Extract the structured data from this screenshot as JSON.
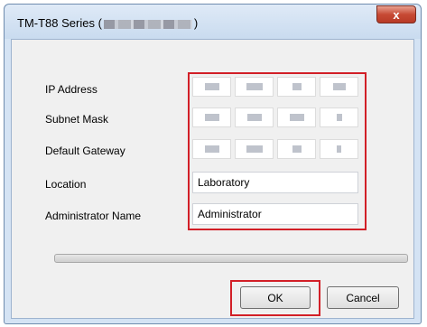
{
  "window": {
    "title_prefix": "TM-T88 Series (",
    "title_suffix": ")",
    "close_label": "x"
  },
  "fields": {
    "ip_address_label": "IP Address",
    "subnet_mask_label": "Subnet Mask",
    "default_gateway_label": "Default Gateway",
    "location_label": "Location",
    "location_value": "Laboratory",
    "administrator_name_label": "Administrator Name",
    "administrator_name_value": "Administrator"
  },
  "progress": {
    "fraction": 0.0
  },
  "buttons": {
    "ok_label": "OK",
    "cancel_label": "Cancel"
  },
  "colors": {
    "highlight": "#d21f27",
    "close_button": "#c74a35"
  },
  "icons": [
    "close-icon"
  ]
}
